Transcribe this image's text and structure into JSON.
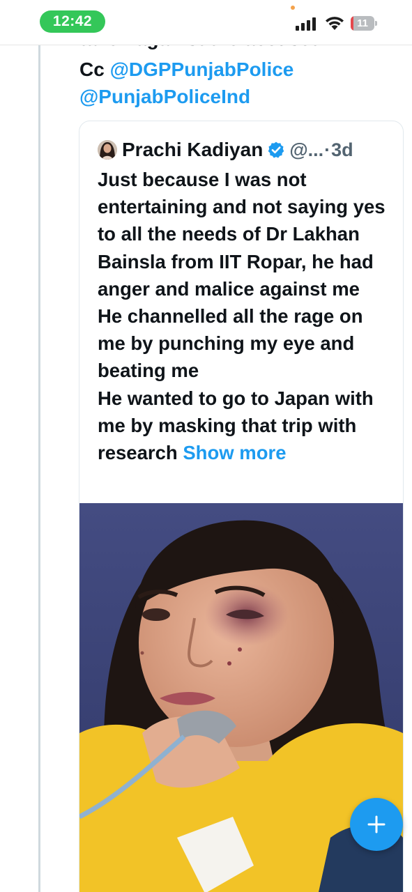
{
  "status_bar": {
    "time": "12:42",
    "battery_level": "11",
    "battery_fraction": 0.11,
    "icons": [
      "signal-icon",
      "wifi-icon",
      "battery-icon"
    ],
    "colors": {
      "time_pill": "#34c759",
      "battery_low": "#e5484d"
    }
  },
  "tweet": {
    "cutoff_line": "taken against the accused?",
    "cc_label": "Cc",
    "mentions": [
      "@DGPPunjabPolice",
      "@PunjabPoliceInd"
    ]
  },
  "quote": {
    "author_name": "Prachi Kadiyan",
    "handle": "@...",
    "separator": "·",
    "time_ago": "3d",
    "body_lines": [
      "Just because I was not entertaining and not saying yes to all the needs of Dr Lakhan Bainsla from IIT Ropar, he had anger and malice against me",
      "He channelled all the rage on me by punching my eye and beating me",
      "He wanted to go to Japan with me by masking that trip with research"
    ],
    "show_more": "Show more",
    "image_icon": "photo-icon"
  },
  "fab": {
    "icon": "plus-icon"
  },
  "colors": {
    "accent": "#1d9bf0",
    "text": "#0f1419",
    "muted": "#536471",
    "border": "#e1e8ed"
  }
}
